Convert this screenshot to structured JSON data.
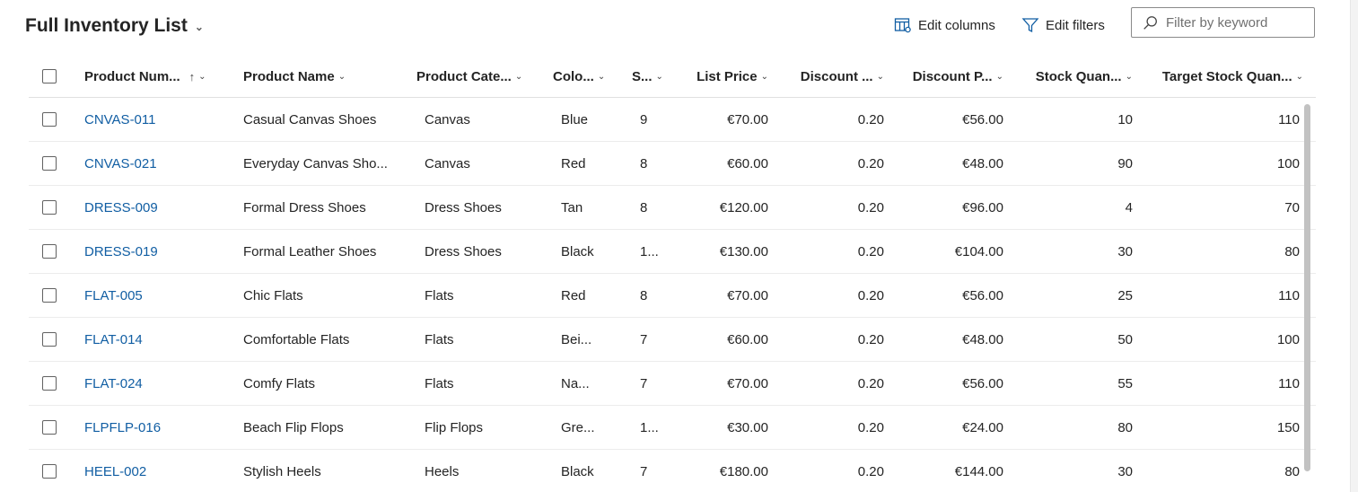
{
  "title": "Full Inventory List",
  "toolbar": {
    "edit_columns": "Edit columns",
    "edit_filters": "Edit filters",
    "search_placeholder": "Filter by keyword"
  },
  "columns": [
    "Product Num...",
    "Product Name",
    "Product Cate...",
    "Colo...",
    "S...",
    "List Price",
    "Discount ...",
    "Discount P...",
    "Stock Quan...",
    "Target Stock Quan..."
  ],
  "rows": [
    [
      "CNVAS-011",
      "Casual Canvas Shoes",
      "Canvas",
      "Blue",
      "9",
      "€70.00",
      "0.20",
      "€56.00",
      "10",
      "110"
    ],
    [
      "CNVAS-021",
      "Everyday Canvas Sho...",
      "Canvas",
      "Red",
      "8",
      "€60.00",
      "0.20",
      "€48.00",
      "90",
      "100"
    ],
    [
      "DRESS-009",
      "Formal Dress Shoes",
      "Dress Shoes",
      "Tan",
      "8",
      "€120.00",
      "0.20",
      "€96.00",
      "4",
      "70"
    ],
    [
      "DRESS-019",
      "Formal Leather Shoes",
      "Dress Shoes",
      "Black",
      "1...",
      "€130.00",
      "0.20",
      "€104.00",
      "30",
      "80"
    ],
    [
      "FLAT-005",
      "Chic Flats",
      "Flats",
      "Red",
      "8",
      "€70.00",
      "0.20",
      "€56.00",
      "25",
      "110"
    ],
    [
      "FLAT-014",
      "Comfortable Flats",
      "Flats",
      "Bei...",
      "7",
      "€60.00",
      "0.20",
      "€48.00",
      "50",
      "100"
    ],
    [
      "FLAT-024",
      "Comfy Flats",
      "Flats",
      "Na...",
      "7",
      "€70.00",
      "0.20",
      "€56.00",
      "55",
      "110"
    ],
    [
      "FLPFLP-016",
      "Beach Flip Flops",
      "Flip Flops",
      "Gre...",
      "1...",
      "€30.00",
      "0.20",
      "€24.00",
      "80",
      "150"
    ],
    [
      "HEEL-002",
      "Stylish Heels",
      "Heels",
      "Black",
      "7",
      "€180.00",
      "0.20",
      "€144.00",
      "30",
      "80"
    ]
  ],
  "sort": {
    "column": "Product Num...",
    "direction": "ascending"
  },
  "colors": {
    "link": "#115ea3",
    "text": "#242424",
    "border": "#e0e0e0"
  },
  "icons": {
    "title": "chevron-down-icon",
    "edit_columns": "edit-columns-icon",
    "edit_filters": "filter-icon",
    "search": "search-icon"
  }
}
